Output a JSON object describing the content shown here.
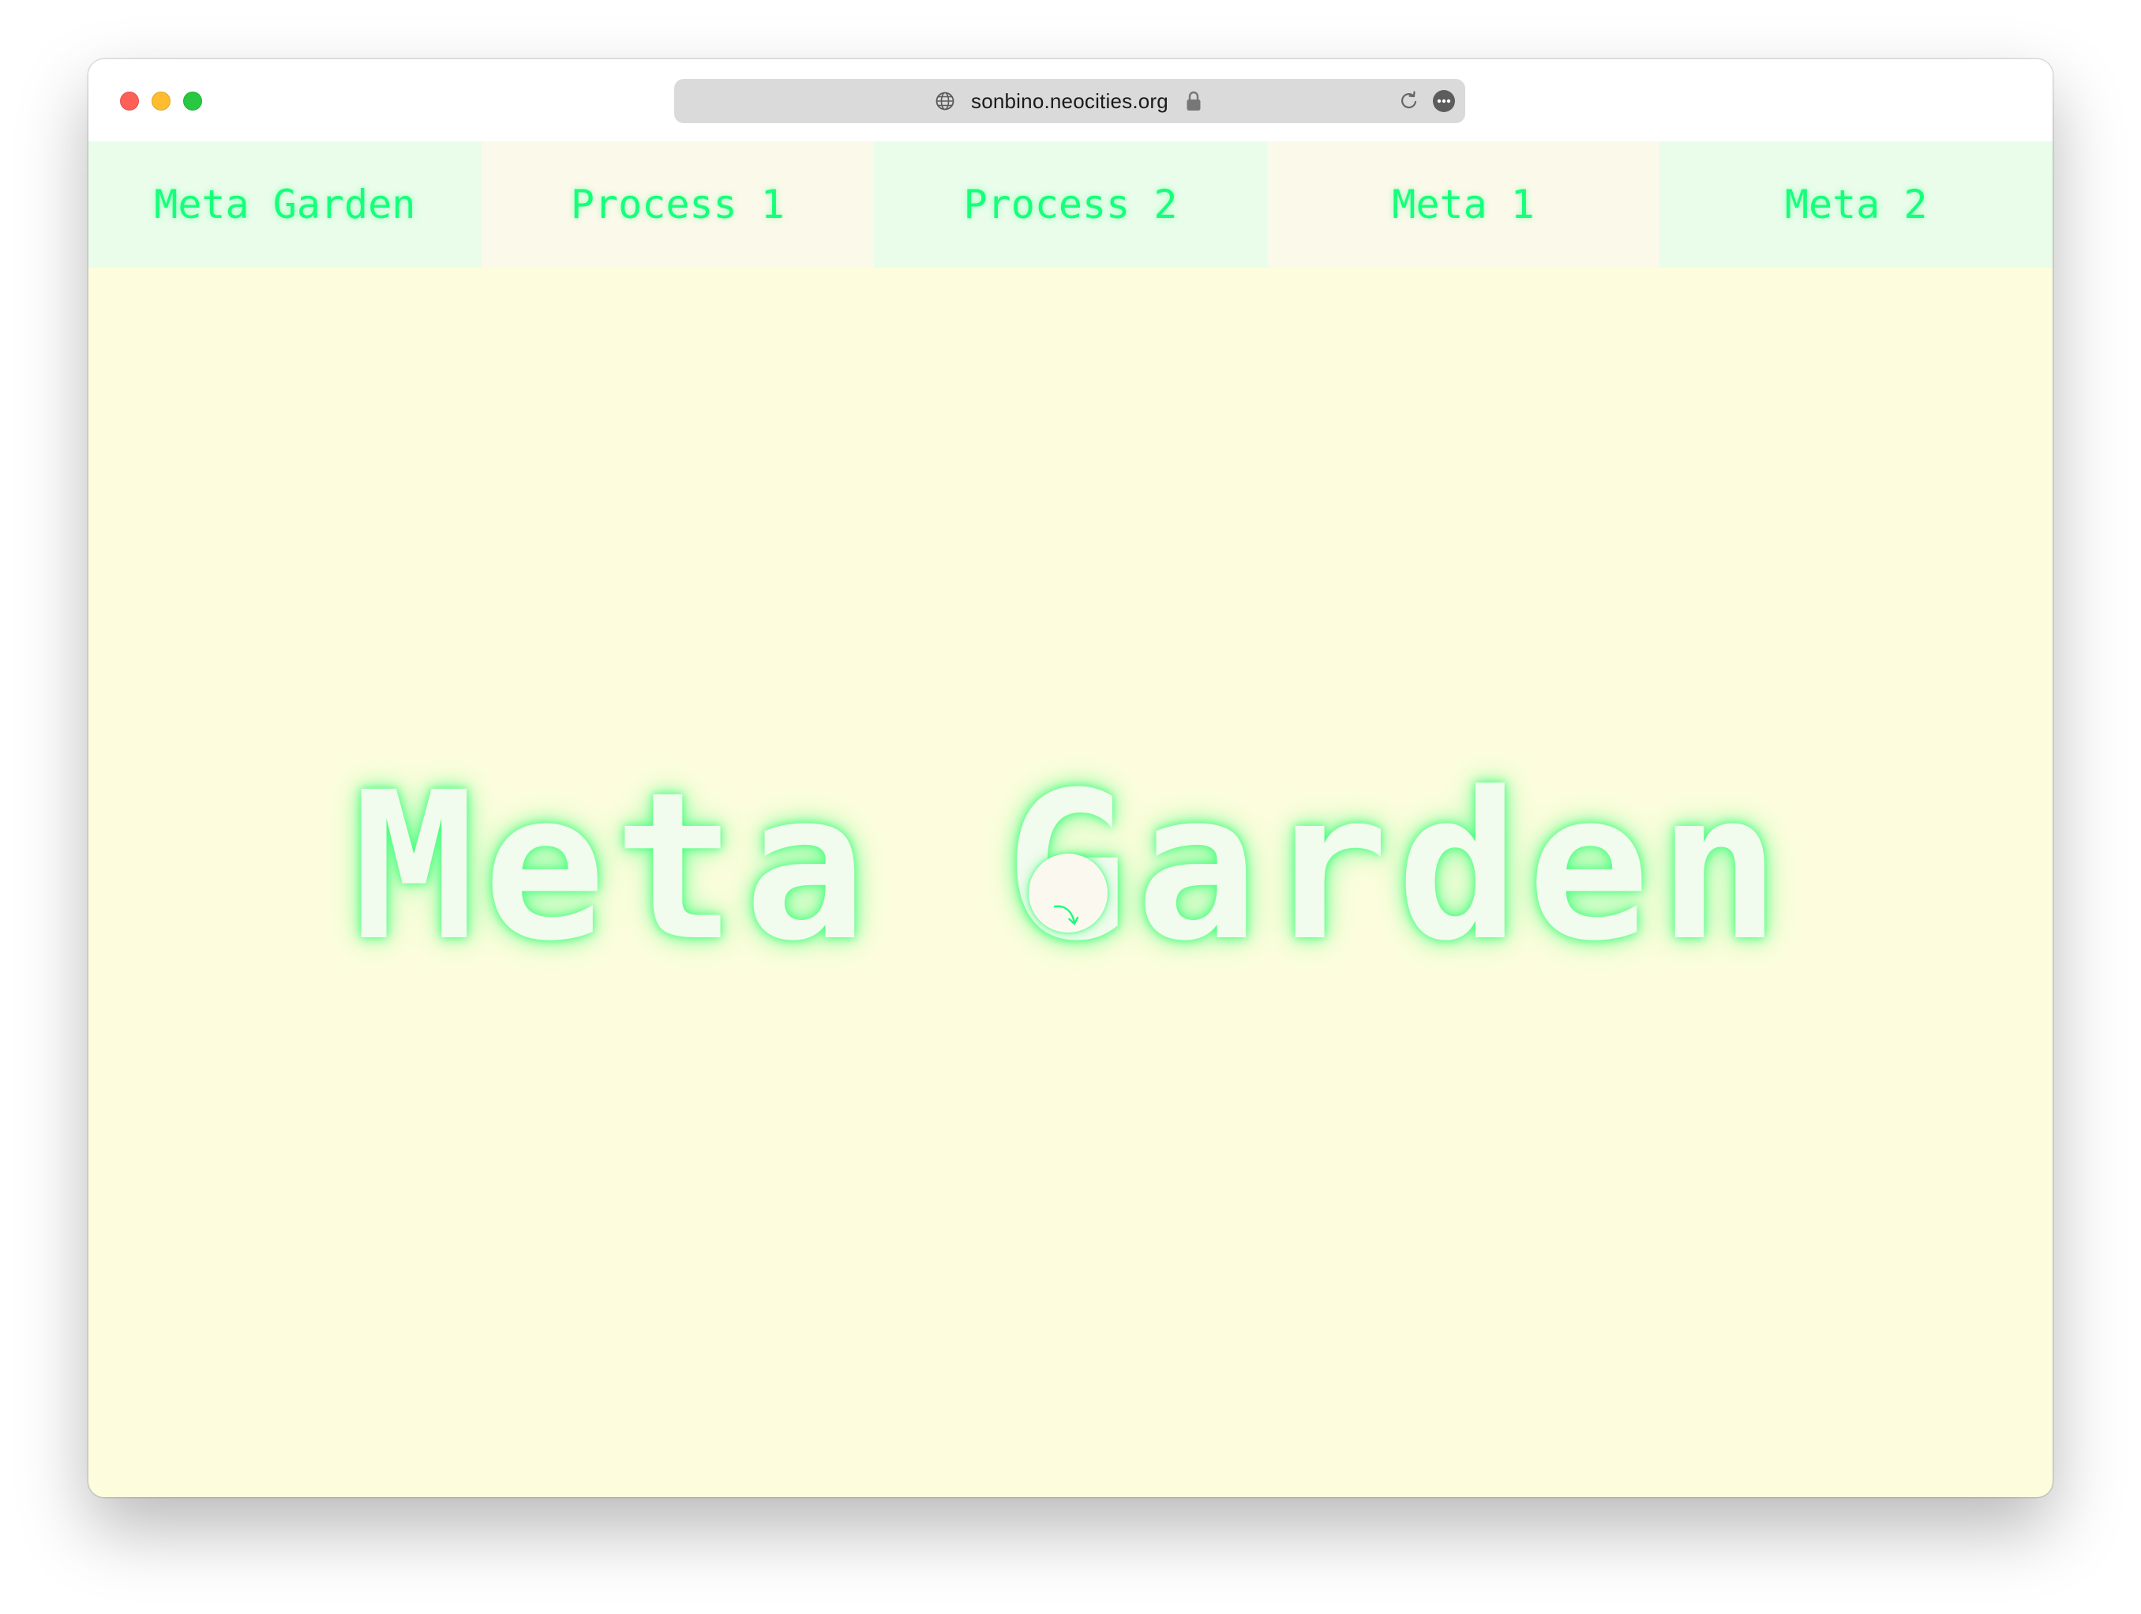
{
  "browser": {
    "url": "sonbino.neocities.org",
    "icons": {
      "site": "globe-icon",
      "security": "lock-icon",
      "reload": "reload-icon",
      "more": "more-icon"
    }
  },
  "nav": {
    "items": [
      {
        "label": "Meta Garden"
      },
      {
        "label": "Process 1"
      },
      {
        "label": "Process 2"
      },
      {
        "label": "Meta 1"
      },
      {
        "label": "Meta 2"
      }
    ]
  },
  "hero": {
    "title": "Meta Garden",
    "scroll_icon": "arrow-down-right-icon"
  },
  "colors": {
    "accent": "#16ff7a",
    "page_background": "#fdfddd",
    "nav_tint_a": "#e9fdea",
    "nav_tint_b": "#fbf9ea",
    "title_fill": "#f1fbee"
  }
}
